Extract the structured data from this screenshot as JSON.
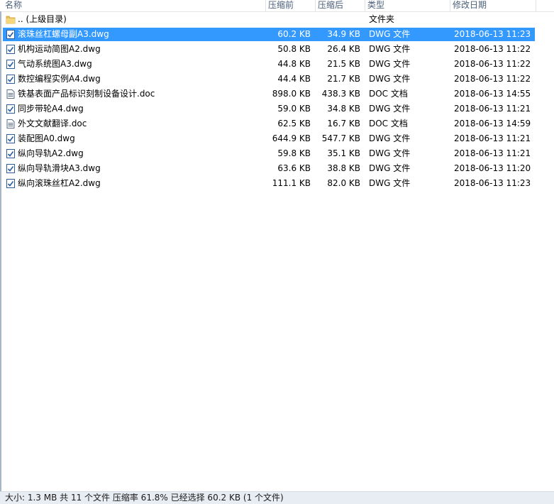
{
  "columns": {
    "name": "名称",
    "size": "压缩前",
    "packed": "压缩后",
    "type": "类型",
    "modified": "修改日期"
  },
  "parent_row": {
    "name": ".. (上级目录)",
    "type": "文件夹",
    "icon": "folder-icon"
  },
  "files": [
    {
      "name": "滚珠丝杠螺母副A3.dwg",
      "size": "60.2 KB",
      "packed": "34.9 KB",
      "type": "DWG 文件",
      "modified": "2018-06-13 11:23",
      "icon": "dwg-file-icon",
      "selected": true
    },
    {
      "name": "机构运动简图A2.dwg",
      "size": "50.8 KB",
      "packed": "26.4 KB",
      "type": "DWG 文件",
      "modified": "2018-06-13 11:22",
      "icon": "dwg-file-icon",
      "selected": false
    },
    {
      "name": "气动系统图A3.dwg",
      "size": "44.8 KB",
      "packed": "21.5 KB",
      "type": "DWG 文件",
      "modified": "2018-06-13 11:22",
      "icon": "dwg-file-icon",
      "selected": false
    },
    {
      "name": "数控编程实例A4.dwg",
      "size": "44.4 KB",
      "packed": "21.7 KB",
      "type": "DWG 文件",
      "modified": "2018-06-13 11:22",
      "icon": "dwg-file-icon",
      "selected": false
    },
    {
      "name": "铁基表面产品标识刻制设备设计.doc",
      "size": "898.0 KB",
      "packed": "438.3 KB",
      "type": "DOC 文档",
      "modified": "2018-06-13 14:55",
      "icon": "doc-file-icon",
      "selected": false
    },
    {
      "name": "同步带轮A4.dwg",
      "size": "59.0 KB",
      "packed": "34.8 KB",
      "type": "DWG 文件",
      "modified": "2018-06-13 11:21",
      "icon": "dwg-file-icon",
      "selected": false
    },
    {
      "name": "外文文献翻译.doc",
      "size": "62.5 KB",
      "packed": "16.7 KB",
      "type": "DOC 文档",
      "modified": "2018-06-13 14:59",
      "icon": "doc-file-icon",
      "selected": false
    },
    {
      "name": "装配图A0.dwg",
      "size": "644.9 KB",
      "packed": "547.7 KB",
      "type": "DWG 文件",
      "modified": "2018-06-13 11:21",
      "icon": "dwg-file-icon",
      "selected": false
    },
    {
      "name": "纵向导轨A2.dwg",
      "size": "59.8 KB",
      "packed": "35.1 KB",
      "type": "DWG 文件",
      "modified": "2018-06-13 11:21",
      "icon": "dwg-file-icon",
      "selected": false
    },
    {
      "name": "纵向导轨滑块A3.dwg",
      "size": "63.6 KB",
      "packed": "38.8 KB",
      "type": "DWG 文件",
      "modified": "2018-06-13 11:20",
      "icon": "dwg-file-icon",
      "selected": false
    },
    {
      "name": "纵向滚珠丝杠A2.dwg",
      "size": "111.1 KB",
      "packed": "82.0 KB",
      "type": "DWG 文件",
      "modified": "2018-06-13 11:23",
      "icon": "dwg-file-icon",
      "selected": false
    }
  ],
  "status": {
    "text": "大小: 1.3 MB 共 11 个文件 压缩率 61.8% 已经选择 60.2 KB (1 个文件)"
  },
  "colors": {
    "selection": "#3399ff",
    "header_text": "#4c607a",
    "statusbar_bg": "#e8edf4"
  }
}
